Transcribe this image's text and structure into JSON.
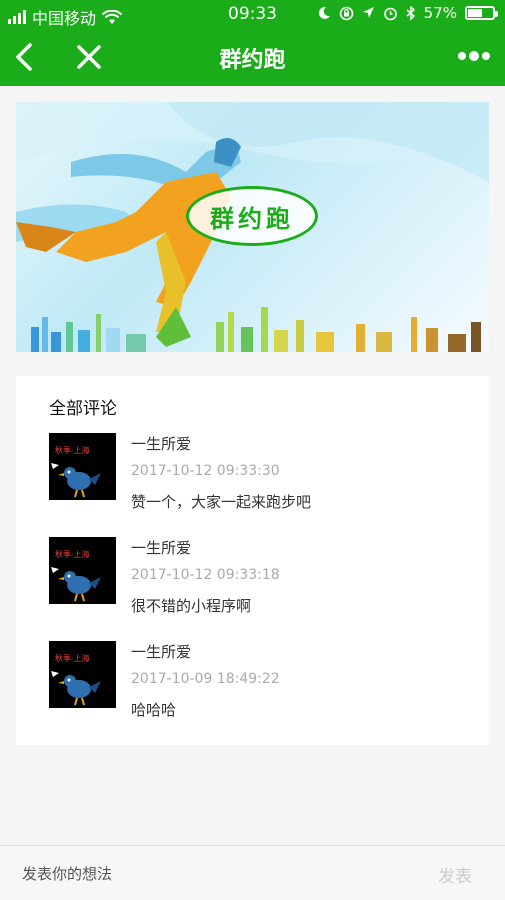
{
  "status_bar": {
    "carrier": "中国移动",
    "time": "09:33",
    "battery_text": "57%",
    "battery_level": 0.57,
    "icons": [
      "signal-icon",
      "wifi-icon",
      "moon-icon",
      "lock-rotation-icon",
      "location-icon",
      "alarm-icon",
      "bluetooth-icon",
      "battery-icon"
    ]
  },
  "navbar": {
    "title": "群约跑",
    "icons": [
      "back-icon",
      "close-icon",
      "more-icon"
    ]
  },
  "banner": {
    "badge_text": "群约跑"
  },
  "comments": {
    "heading": "全部评论",
    "items": [
      {
        "name": "一生所爱",
        "time": "2017-10-12 09:33:30",
        "text": "赞一个，大家一起来跑步吧"
      },
      {
        "name": "一生所爱",
        "time": "2017-10-12 09:33:18",
        "text": "很不错的小程序啊"
      },
      {
        "name": "一生所爱",
        "time": "2017-10-09 18:49:22",
        "text": "哈哈哈"
      }
    ]
  },
  "bottom_bar": {
    "placeholder": "发表你的想法",
    "send_label": "发表"
  },
  "colors": {
    "brand": "#1aad19",
    "muted": "#aaaaaa"
  }
}
